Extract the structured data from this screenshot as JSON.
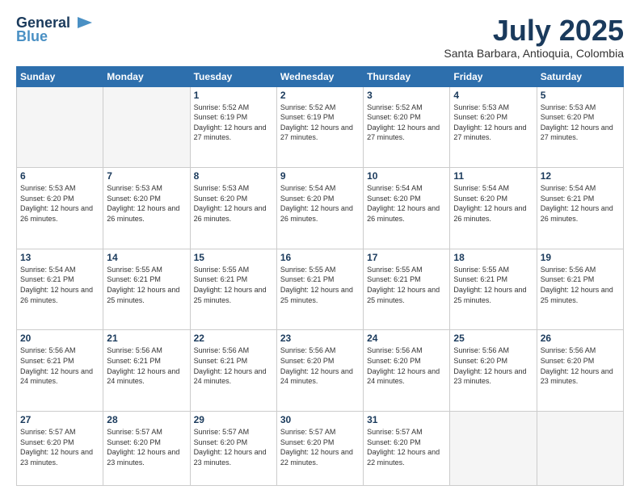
{
  "header": {
    "logo_line1": "General",
    "logo_line2": "Blue",
    "month": "July 2025",
    "location": "Santa Barbara, Antioquia, Colombia"
  },
  "weekdays": [
    "Sunday",
    "Monday",
    "Tuesday",
    "Wednesday",
    "Thursday",
    "Friday",
    "Saturday"
  ],
  "weeks": [
    [
      {
        "day": "",
        "detail": ""
      },
      {
        "day": "",
        "detail": ""
      },
      {
        "day": "1",
        "detail": "Sunrise: 5:52 AM\nSunset: 6:19 PM\nDaylight: 12 hours and 27 minutes."
      },
      {
        "day": "2",
        "detail": "Sunrise: 5:52 AM\nSunset: 6:19 PM\nDaylight: 12 hours and 27 minutes."
      },
      {
        "day": "3",
        "detail": "Sunrise: 5:52 AM\nSunset: 6:20 PM\nDaylight: 12 hours and 27 minutes."
      },
      {
        "day": "4",
        "detail": "Sunrise: 5:53 AM\nSunset: 6:20 PM\nDaylight: 12 hours and 27 minutes."
      },
      {
        "day": "5",
        "detail": "Sunrise: 5:53 AM\nSunset: 6:20 PM\nDaylight: 12 hours and 27 minutes."
      }
    ],
    [
      {
        "day": "6",
        "detail": "Sunrise: 5:53 AM\nSunset: 6:20 PM\nDaylight: 12 hours and 26 minutes."
      },
      {
        "day": "7",
        "detail": "Sunrise: 5:53 AM\nSunset: 6:20 PM\nDaylight: 12 hours and 26 minutes."
      },
      {
        "day": "8",
        "detail": "Sunrise: 5:53 AM\nSunset: 6:20 PM\nDaylight: 12 hours and 26 minutes."
      },
      {
        "day": "9",
        "detail": "Sunrise: 5:54 AM\nSunset: 6:20 PM\nDaylight: 12 hours and 26 minutes."
      },
      {
        "day": "10",
        "detail": "Sunrise: 5:54 AM\nSunset: 6:20 PM\nDaylight: 12 hours and 26 minutes."
      },
      {
        "day": "11",
        "detail": "Sunrise: 5:54 AM\nSunset: 6:20 PM\nDaylight: 12 hours and 26 minutes."
      },
      {
        "day": "12",
        "detail": "Sunrise: 5:54 AM\nSunset: 6:21 PM\nDaylight: 12 hours and 26 minutes."
      }
    ],
    [
      {
        "day": "13",
        "detail": "Sunrise: 5:54 AM\nSunset: 6:21 PM\nDaylight: 12 hours and 26 minutes."
      },
      {
        "day": "14",
        "detail": "Sunrise: 5:55 AM\nSunset: 6:21 PM\nDaylight: 12 hours and 25 minutes."
      },
      {
        "day": "15",
        "detail": "Sunrise: 5:55 AM\nSunset: 6:21 PM\nDaylight: 12 hours and 25 minutes."
      },
      {
        "day": "16",
        "detail": "Sunrise: 5:55 AM\nSunset: 6:21 PM\nDaylight: 12 hours and 25 minutes."
      },
      {
        "day": "17",
        "detail": "Sunrise: 5:55 AM\nSunset: 6:21 PM\nDaylight: 12 hours and 25 minutes."
      },
      {
        "day": "18",
        "detail": "Sunrise: 5:55 AM\nSunset: 6:21 PM\nDaylight: 12 hours and 25 minutes."
      },
      {
        "day": "19",
        "detail": "Sunrise: 5:56 AM\nSunset: 6:21 PM\nDaylight: 12 hours and 25 minutes."
      }
    ],
    [
      {
        "day": "20",
        "detail": "Sunrise: 5:56 AM\nSunset: 6:21 PM\nDaylight: 12 hours and 24 minutes."
      },
      {
        "day": "21",
        "detail": "Sunrise: 5:56 AM\nSunset: 6:21 PM\nDaylight: 12 hours and 24 minutes."
      },
      {
        "day": "22",
        "detail": "Sunrise: 5:56 AM\nSunset: 6:21 PM\nDaylight: 12 hours and 24 minutes."
      },
      {
        "day": "23",
        "detail": "Sunrise: 5:56 AM\nSunset: 6:20 PM\nDaylight: 12 hours and 24 minutes."
      },
      {
        "day": "24",
        "detail": "Sunrise: 5:56 AM\nSunset: 6:20 PM\nDaylight: 12 hours and 24 minutes."
      },
      {
        "day": "25",
        "detail": "Sunrise: 5:56 AM\nSunset: 6:20 PM\nDaylight: 12 hours and 23 minutes."
      },
      {
        "day": "26",
        "detail": "Sunrise: 5:56 AM\nSunset: 6:20 PM\nDaylight: 12 hours and 23 minutes."
      }
    ],
    [
      {
        "day": "27",
        "detail": "Sunrise: 5:57 AM\nSunset: 6:20 PM\nDaylight: 12 hours and 23 minutes."
      },
      {
        "day": "28",
        "detail": "Sunrise: 5:57 AM\nSunset: 6:20 PM\nDaylight: 12 hours and 23 minutes."
      },
      {
        "day": "29",
        "detail": "Sunrise: 5:57 AM\nSunset: 6:20 PM\nDaylight: 12 hours and 23 minutes."
      },
      {
        "day": "30",
        "detail": "Sunrise: 5:57 AM\nSunset: 6:20 PM\nDaylight: 12 hours and 22 minutes."
      },
      {
        "day": "31",
        "detail": "Sunrise: 5:57 AM\nSunset: 6:20 PM\nDaylight: 12 hours and 22 minutes."
      },
      {
        "day": "",
        "detail": ""
      },
      {
        "day": "",
        "detail": ""
      }
    ]
  ]
}
